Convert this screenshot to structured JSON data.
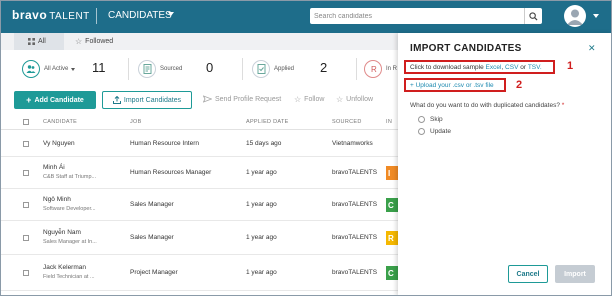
{
  "header": {
    "logo_brand": "bravo",
    "logo_suffix": "TALENT",
    "section_title": "CANDIDATES",
    "search_placeholder": "Search candidates"
  },
  "tabs": [
    {
      "label": "All",
      "active": true
    },
    {
      "label": "Followed",
      "active": false
    }
  ],
  "stats": [
    {
      "label": "All Active",
      "count": "11"
    },
    {
      "label": "Sourced",
      "count": "0"
    },
    {
      "label": "Applied",
      "count": "2"
    },
    {
      "label": "In R",
      "count": ""
    }
  ],
  "toolbar": {
    "add_candidate": "Add Candidate",
    "import_candidates": "Import Candidates",
    "send_profile_request": "Send Profile Request",
    "follow": "Follow",
    "unfollow": "Unfollow"
  },
  "table": {
    "columns": [
      "CANDIDATE",
      "JOB",
      "APPLIED DATE",
      "SOURCED",
      "IN"
    ],
    "rows": [
      {
        "name": "Vy Nguyen",
        "subtitle": "",
        "job": "Human Resource Intern",
        "applied": "15 days ago",
        "source": "Vietnamworks",
        "badge": "",
        "badge_color": ""
      },
      {
        "name": "Minh Ái",
        "subtitle": "C&B Staff at Triump...",
        "job": "Human Resources Manager",
        "applied": "1 year ago",
        "source": "bravoTALENTS",
        "badge": "I",
        "badge_color": "#f08a24"
      },
      {
        "name": "Ngô Minh",
        "subtitle": "Software Developer...",
        "job": "Sales Manager",
        "applied": "1 year ago",
        "source": "bravoTALENTS",
        "badge": "C",
        "badge_color": "#3aa04a"
      },
      {
        "name": "Nguyễn Nam",
        "subtitle": "Sales Manager at In...",
        "job": "Sales Manager",
        "applied": "1 year ago",
        "source": "bravoTALENTS",
        "badge": "R",
        "badge_color": "#f5b800"
      },
      {
        "name": "Jack Kelerman",
        "subtitle": "Field Technician at ...",
        "job": "Project Manager",
        "applied": "1 year ago",
        "source": "bravoTALENTS",
        "badge": "C",
        "badge_color": "#3aa04a"
      }
    ]
  },
  "modal": {
    "title": "IMPORT CANDIDATES",
    "sample_prefix": "Click to download sample",
    "sample_excel": "Excel",
    "sample_csv": "CSV",
    "sample_or": "or",
    "sample_tsv": "TSV.",
    "upload_link": "+ Upload your .csv or .tsv file",
    "duplicate_question": "What do you want to do with duplicated candidates?",
    "duplicate_required_mark": "*",
    "options": [
      "Skip",
      "Update"
    ],
    "cancel_label": "Cancel",
    "import_label": "Import",
    "annotation_1": "1",
    "annotation_2": "2"
  },
  "colors": {
    "header_bg": "#1e6d8a",
    "accent": "#1e9a97",
    "highlight_red": "#d01e1e",
    "link_blue": "#1e8ab0"
  }
}
